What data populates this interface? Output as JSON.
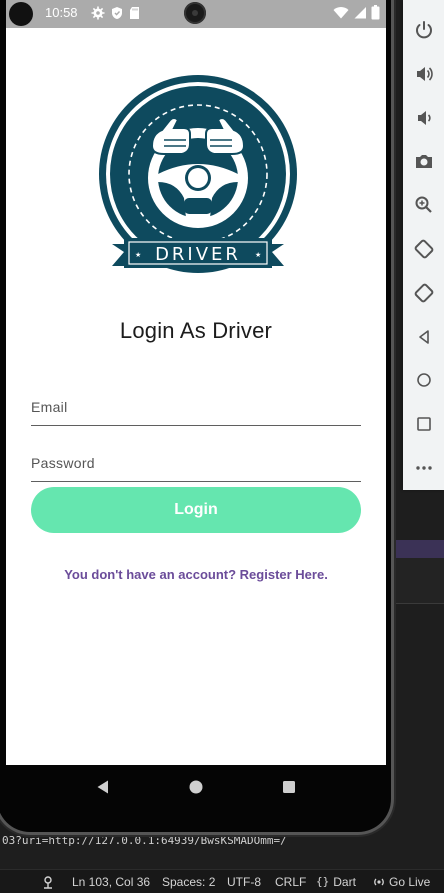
{
  "status_bar": {
    "time": "10:58"
  },
  "login": {
    "title": "Login As Driver",
    "logo_text": "DRIVER",
    "email_placeholder": "Email",
    "password_placeholder": "Password",
    "button_label": "Login",
    "register_text": "You don't have an account? Register Here."
  },
  "colors": {
    "accent_green": "#65e6af",
    "link_purple": "#6b4c9a",
    "logo_teal": "#0e4a5e"
  },
  "ide": {
    "debug_url": "03?uri=http://127.0.0.1:64939/BwsKSMADOmm=/",
    "status": {
      "position": "Ln 103, Col 36",
      "spaces": "Spaces: 2",
      "encoding": "UTF-8",
      "line_ending": "CRLF",
      "language": "Dart",
      "go_live": "Go Live"
    }
  }
}
